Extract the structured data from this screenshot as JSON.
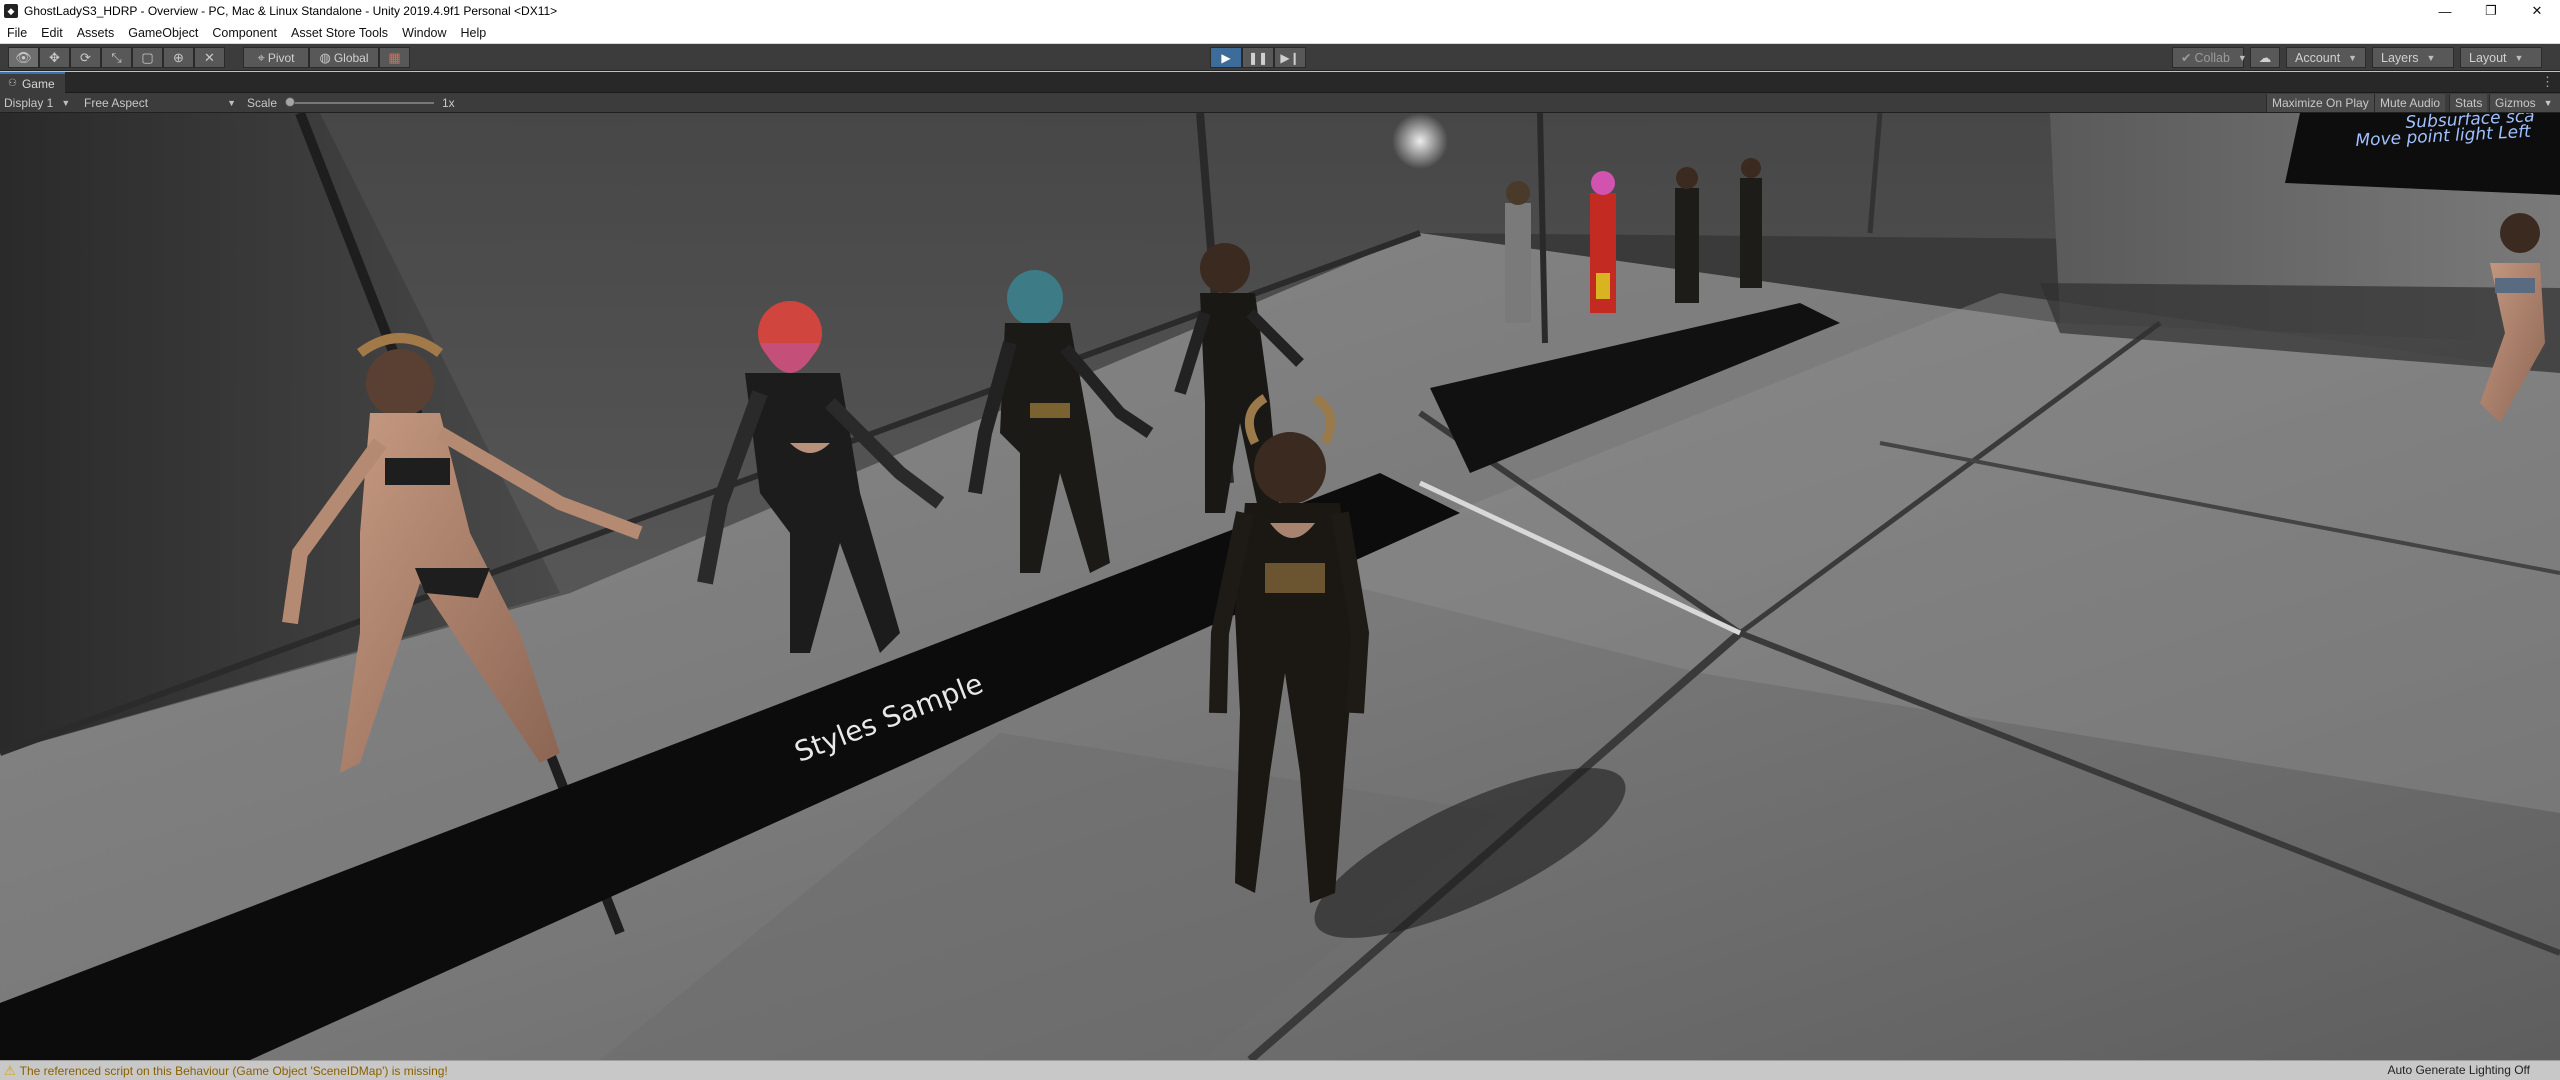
{
  "window": {
    "title": "GhostLadyS3_HDRP - Overview - PC, Mac & Linux Standalone - Unity 2019.4.9f1 Personal <DX11>",
    "app_icon": "unity-icon",
    "minimize_glyph": "—",
    "restore_glyph": "❐",
    "close_glyph": "✕"
  },
  "menu": {
    "items": [
      "File",
      "Edit",
      "Assets",
      "GameObject",
      "Component",
      "Asset Store Tools",
      "Window",
      "Help"
    ]
  },
  "toolbar": {
    "tool_icons": [
      "hand-icon",
      "move-icon",
      "rotate-icon",
      "scale-icon",
      "rect-icon",
      "transform-icon",
      "custom-tool-icon"
    ],
    "pivot_label": "Pivot",
    "global_label": "Global",
    "collab_label": "Collab",
    "account_label": "Account",
    "layers_label": "Layers",
    "layout_label": "Layout",
    "play_state": "playing"
  },
  "game_tab": {
    "label": "Game"
  },
  "game_toolbar": {
    "display": "Display 1",
    "aspect": "Free Aspect",
    "scale_label": "Scale",
    "scale_value": "1x",
    "maximize_on_play": "Maximize On Play",
    "mute_audio": "Mute Audio",
    "stats": "Stats",
    "gizmos": "Gizmos"
  },
  "scene": {
    "sign_text": "Styles Sample",
    "screen_line1": "Subsurface sca",
    "screen_line2": "Move point light Left"
  },
  "status": {
    "warning": "The referenced script on this Behaviour (Game Object 'SceneIDMap') is missing!",
    "right_text": "Auto Generate Lighting Off"
  },
  "colors": {
    "editor_dark": "#3c3c3c",
    "play_accent": "#3d6b9a",
    "warning_text": "#8a6100"
  }
}
